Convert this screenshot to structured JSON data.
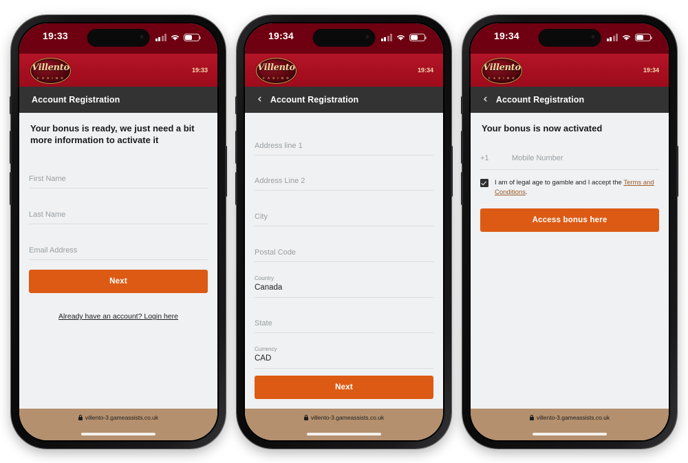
{
  "brand": {
    "logo_word": "Villento",
    "logo_sub": "C A S I N O",
    "logo_alt": "villento-casino-logo"
  },
  "colors": {
    "status_red": "#6e0011",
    "brand_red": "#b41528",
    "nav_dark": "#333333",
    "page_bg": "#eff1f2",
    "cta_orange": "#dc5a14",
    "browser_tan": "#b4906e",
    "link_brown": "#9b5a2a"
  },
  "browser": {
    "url": "villento-3.gameassists.co.uk",
    "lock_icon": "lock-icon"
  },
  "status_icons": {
    "signal": "cellular-signal-icon",
    "wifi": "wifi-icon",
    "battery": "battery-icon"
  },
  "phones": [
    {
      "id": "phone-1",
      "status_time": "19:33",
      "brand_time": "19:33",
      "nav": {
        "title": "Account Registration",
        "back": "",
        "has_back": false
      },
      "headline": "Your bonus is ready, we just need a bit more information to activate it",
      "fields": [
        {
          "label": "First Name",
          "value": ""
        },
        {
          "label": "Last Name",
          "value": ""
        },
        {
          "label": "Email Address",
          "value": ""
        }
      ],
      "cta": "Next",
      "login_link": "Already have an account? Login here"
    },
    {
      "id": "phone-2",
      "status_time": "19:34",
      "brand_time": "19:34",
      "nav": {
        "title": "Account Registration",
        "back": "‹",
        "has_back": true
      },
      "headline": "",
      "fields": [
        {
          "label": "Address line 1",
          "value": ""
        },
        {
          "label": "Address Line 2",
          "value": ""
        },
        {
          "label": "City",
          "value": ""
        },
        {
          "label": "Postal Code",
          "value": ""
        },
        {
          "label": "Country",
          "value": "Canada"
        },
        {
          "label": "State",
          "value": ""
        },
        {
          "label": "Currency",
          "value": "CAD"
        }
      ],
      "cta": "Next"
    },
    {
      "id": "phone-3",
      "status_time": "19:34",
      "brand_time": "19:34",
      "nav": {
        "title": "Account Registration",
        "back": "‹",
        "has_back": true
      },
      "headline": "Your bonus is now activated",
      "phone_field": {
        "country_code": "+1",
        "placeholder": "Mobile Number"
      },
      "terms": {
        "checked": true,
        "text_before": "I am of legal age to gamble and I accept the ",
        "link": "Terms and Conditions",
        "text_after": "."
      },
      "cta": "Access bonus here"
    }
  ]
}
